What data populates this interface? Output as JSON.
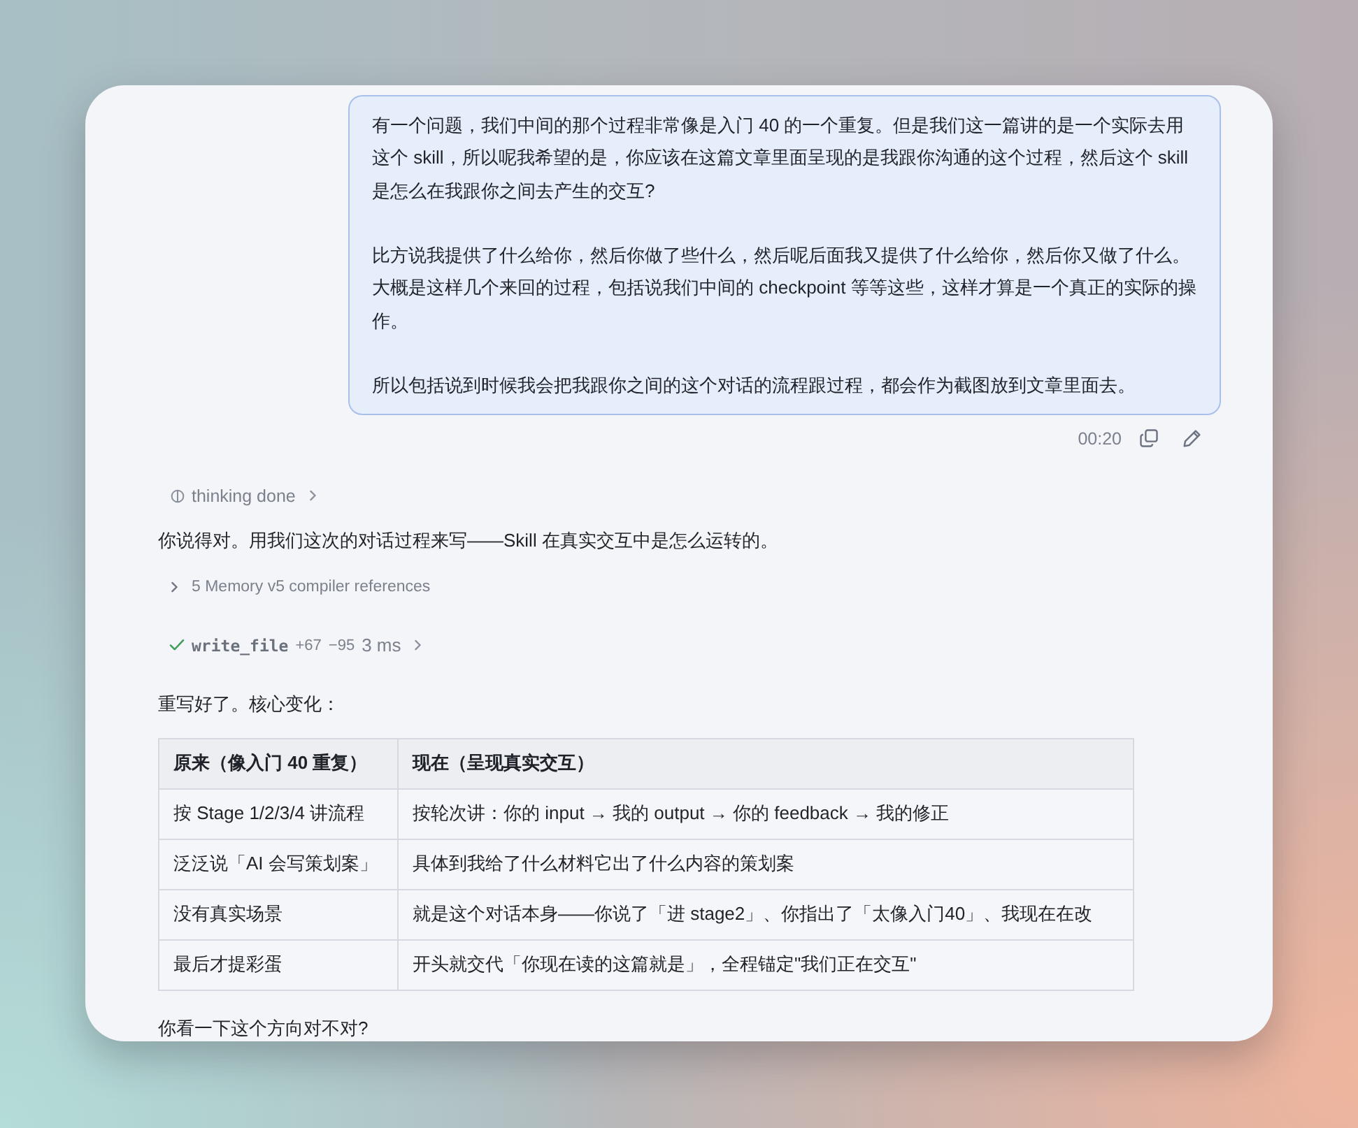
{
  "user_message": {
    "paragraphs": [
      "有一个问题，我们中间的那个过程非常像是入门 40 的一个重复。但是我们这一篇讲的是一个实际去用这个 skill，所以呢我希望的是，你应该在这篇文章里面呈现的是我跟你沟通的这个过程，然后这个 skill 是怎么在我跟你之间去产生的交互?",
      "比方说我提供了什么给你，然后你做了些什么，然后呢后面我又提供了什么给你，然后你又做了什么。大概是这样几个来回的过程，包括说我们中间的 checkpoint 等等这些，这样才算是一个真正的实际的操作。",
      "所以包括说到时候我会把我跟你之间的这个对话的流程跟过程，都会作为截图放到文章里面去。"
    ],
    "time": "00:20"
  },
  "assistant": {
    "thinking": {
      "label": "thinking done",
      "expanded": false
    },
    "blocks": [
      {
        "kind": "text",
        "text": "你说得对。用我们这次的对话过程来写——Skill 在真实交互中是怎么运转的。"
      },
      {
        "kind": "references",
        "label": "5 Memory v5 compiler references",
        "expanded": false
      },
      {
        "kind": "tool",
        "name": "write_file",
        "added": "+67",
        "removed": "−95",
        "duration": "3 ms",
        "done": true,
        "expanded": false
      },
      {
        "kind": "text",
        "text": "重写好了。核心变化："
      },
      {
        "kind": "table",
        "columns": [
          "原来（像入门 40 重复）",
          "现在（呈现真实交互）"
        ],
        "rows": [
          [
            "按 Stage 1/2/3/4 讲流程",
            "按轮次讲：你的 input → 我的 output → 你的 feedback → 我的修正"
          ],
          [
            "泛泛说「AI 会写策划案」",
            "具体到我给了什么材料它出了什么内容的策划案"
          ],
          [
            "没有真实场景",
            "就是这个对话本身——你说了「进 stage2」、你指出了「太像入门40」、我现在在改"
          ],
          [
            "最后才提彩蛋",
            "开头就交代「你现在读的这篇就是」，全程锚定\"我们正在交互\""
          ]
        ]
      },
      {
        "kind": "text",
        "text": "你看一下这个方向对不对?"
      }
    ]
  }
}
